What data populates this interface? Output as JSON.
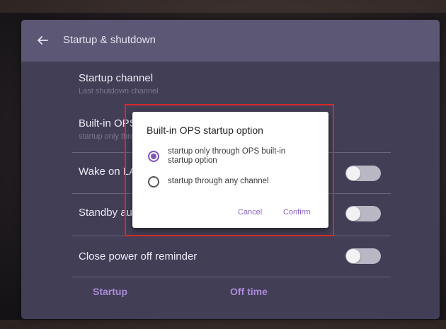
{
  "header": {
    "title": "Startup & shutdown"
  },
  "settings": {
    "startup_channel": {
      "title": "Startup channel",
      "subtitle": "Last shutdown channel"
    },
    "builtin_ops": {
      "title": "Built-in OPS startup option",
      "subtitle": "startup only through OPS built-in startup option"
    },
    "wake_on_lan": {
      "title": "Wake on LAN",
      "enabled": false
    },
    "standby": {
      "title": "Standby auto power on",
      "enabled": false
    },
    "close_power_off_reminder": {
      "title": "Close power off reminder",
      "enabled": false
    }
  },
  "bottom": {
    "startup_label": "Startup",
    "off_time_label": "Off time"
  },
  "dialog": {
    "title": "Built-in OPS startup option",
    "options": [
      {
        "label": "startup only through OPS built-in startup option",
        "selected": true
      },
      {
        "label": "startup through any channel",
        "selected": false
      }
    ],
    "cancel_label": "Cancel",
    "confirm_label": "Confirm"
  },
  "colors": {
    "panel": "#423e56",
    "header": "#5c5775",
    "accent": "#8a63c7",
    "highlight": "#d52a2a"
  },
  "icons": {
    "back": "back-arrow-icon"
  }
}
